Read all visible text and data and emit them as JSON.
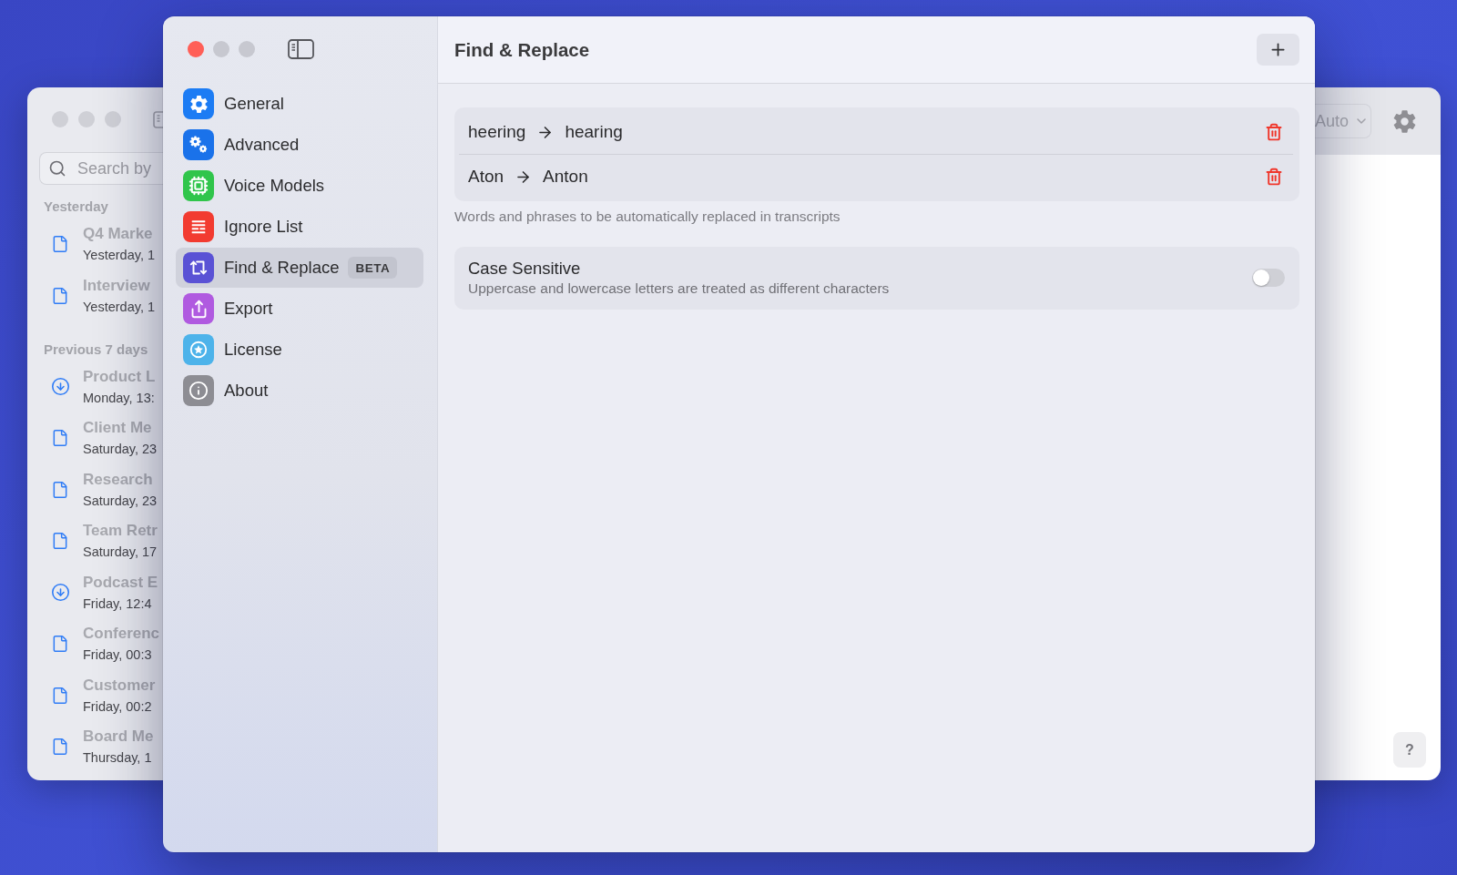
{
  "background_window": {
    "window_controls": [
      {
        "enabled": false
      },
      {
        "enabled": false
      },
      {
        "enabled": false
      }
    ],
    "search": {
      "placeholder": "Search by"
    },
    "sections": [
      {
        "title": "Yesterday",
        "items": [
          {
            "kind": "document",
            "title": "Q4 Marke",
            "subtitle": "Yesterday, 1"
          },
          {
            "kind": "document",
            "title": "Interview",
            "subtitle": "Yesterday, 1"
          }
        ]
      },
      {
        "title": "Previous 7 days",
        "items": [
          {
            "kind": "download",
            "title": "Product L",
            "subtitle": "Monday, 13:"
          },
          {
            "kind": "document",
            "title": "Client Me",
            "subtitle": "Saturday, 23"
          },
          {
            "kind": "document",
            "title": "Research",
            "subtitle": "Saturday, 23"
          },
          {
            "kind": "document",
            "title": "Team Retr",
            "subtitle": "Saturday, 17"
          },
          {
            "kind": "download",
            "title": "Podcast E",
            "subtitle": "Friday, 12:4"
          },
          {
            "kind": "document",
            "title": "Conferenc",
            "subtitle": "Friday, 00:3"
          },
          {
            "kind": "document",
            "title": "Customer",
            "subtitle": "Friday, 00:2"
          },
          {
            "kind": "document",
            "title": "Board Me",
            "subtitle": "Thursday, 1"
          }
        ]
      }
    ],
    "toolbar": {
      "dropdown": {
        "value": "Auto"
      }
    },
    "help_button": "?"
  },
  "settings_window": {
    "window_controls": [
      {
        "enabled": true
      },
      {
        "enabled": false
      },
      {
        "enabled": false
      }
    ],
    "sidebar": {
      "items": [
        {
          "label": "General",
          "color": "#1c7cf4",
          "selected": false
        },
        {
          "label": "Advanced",
          "color": "#1a72ea",
          "selected": false
        },
        {
          "label": "Voice Models",
          "color": "#30c54b",
          "selected": false
        },
        {
          "label": "Ignore List",
          "color": "#f23b30",
          "selected": false
        },
        {
          "label": "Find & Replace",
          "color": "#5a52d5",
          "selected": true,
          "badge": "BETA"
        },
        {
          "label": "Export",
          "color": "#b05ae0",
          "selected": false
        },
        {
          "label": "License",
          "color": "#4db3ea",
          "selected": false
        },
        {
          "label": "About",
          "color": "#8d8d93",
          "selected": false
        }
      ]
    },
    "header": {
      "title": "Find & Replace"
    },
    "replacements": {
      "rules": [
        {
          "find": "heering",
          "replace": "hearing"
        },
        {
          "find": "Aton",
          "replace": "Anton"
        }
      ],
      "caption": "Words and phrases to be automatically replaced in transcripts"
    },
    "options": [
      {
        "title": "Case Sensitive",
        "description": "Uppercase and lowercase letters are treated as different characters",
        "on": false
      }
    ]
  }
}
